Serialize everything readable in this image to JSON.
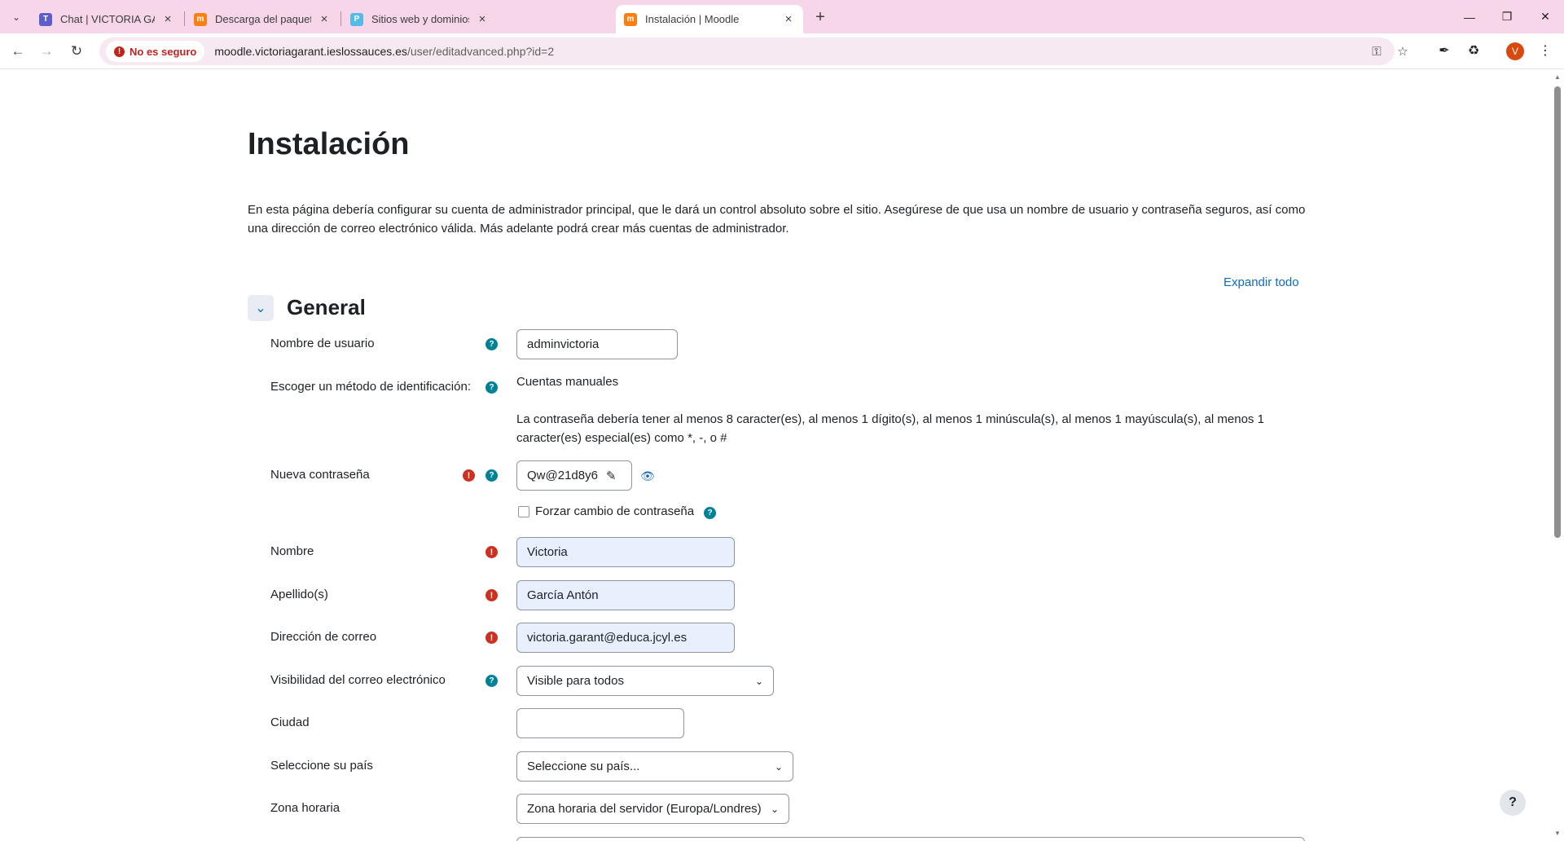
{
  "browser": {
    "tabs": [
      {
        "title": "Chat | VICTORIA GARCÍA ANTÓ",
        "favicon": "teams-icon",
        "color": "#5b5fc7"
      },
      {
        "title": "Descarga del paquete | Descarg",
        "favicon": "moodle-icon",
        "color": "#f98012"
      },
      {
        "title": "Sitios web y dominios - Plesk -",
        "favicon": "plesk-icon",
        "color": "#52bbe6"
      },
      {
        "title": "Instalación | Moodle",
        "favicon": "moodle-icon",
        "color": "#f98012",
        "active": true
      }
    ],
    "security_chip": "No es seguro",
    "url_host": "moodle.victoriagarant.ieslossauces.es",
    "url_path": "/user/editadvanced.php?id=2",
    "profile_initial": "V",
    "tab_strip_color": "#f6d6e8"
  },
  "page": {
    "title": "Instalación",
    "intro": "En esta página debería configurar su cuenta de administrador principal, que le dará un control absoluto sobre el sitio. Asegúrese de que usa un nombre de usuario y contraseña seguros, así como una dirección de correo electrónico válida. Más adelante podrá crear más cuentas de administrador.",
    "expand_all": "Expandir todo",
    "section_title": "General",
    "accent_color": "#0f6cbf",
    "help_fab": "?"
  },
  "form": {
    "username": {
      "label": "Nombre de usuario",
      "value": "adminvictoria"
    },
    "auth": {
      "label": "Escoger un método de identificación:",
      "value": "Cuentas manuales"
    },
    "password_rules": "La contraseña debería tener al menos 8 caracter(es), al menos 1 dígito(s), al menos 1 minúscula(s), al menos 1 mayúscula(s), al menos 1 caracter(es) especial(es) como *, -, o #",
    "new_password": {
      "label": "Nueva contraseña",
      "value": "Qw@21d8y6"
    },
    "force_change": {
      "label": "Forzar cambio de contraseña",
      "checked": false
    },
    "firstname": {
      "label": "Nombre",
      "value": "Victoria"
    },
    "lastname": {
      "label": "Apellido(s)",
      "value": "García Antón"
    },
    "email": {
      "label": "Dirección de correo",
      "value": "victoria.garant@educa.jcyl.es"
    },
    "email_visibility": {
      "label": "Visibilidad del correo electrónico",
      "value": "Visible para todos"
    },
    "city": {
      "label": "Ciudad",
      "value": ""
    },
    "country": {
      "label": "Seleccione su país",
      "value": "Seleccione su país..."
    },
    "timezone": {
      "label": "Zona horaria",
      "value": "Zona horaria del servidor (Europa/Londres)"
    }
  }
}
